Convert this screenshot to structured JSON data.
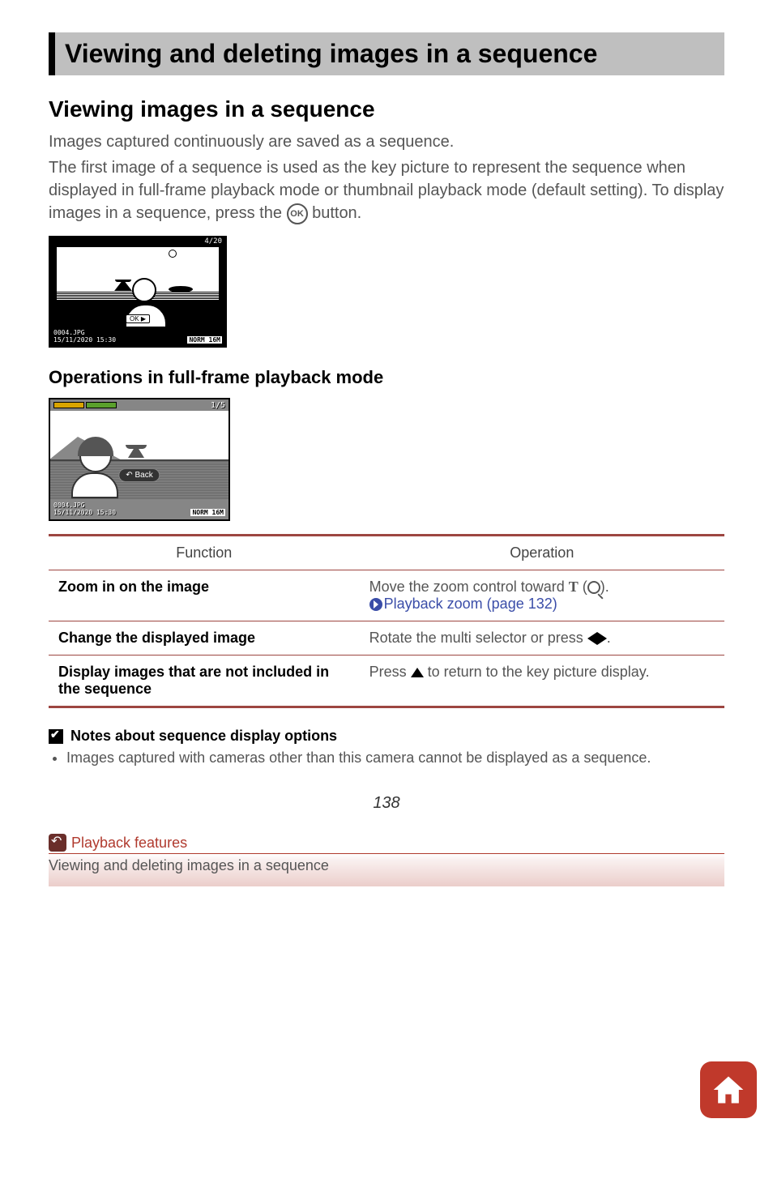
{
  "title": "Viewing and deleting images in a sequence",
  "section1": "Viewing images in a sequence",
  "para1a": "Images captured continuously are saved as a sequence.",
  "para1b_pre": "The first image of a sequence is used as the key picture to represent the sequence when displayed in full-frame playback mode or thumbnail playback mode (default setting). To display images in a sequence, press the ",
  "para1b_post": " button.",
  "ok_label": "OK",
  "lcd": {
    "counter": "4/20",
    "ok_play": "OK ▶",
    "filename": "0004.JPG",
    "datetime": "15/11/2020 15:30",
    "norm": "NORM 16M"
  },
  "section2": "Operations in full-frame playback mode",
  "lcd2": {
    "counter": "1/5",
    "back": "Back",
    "filename": "0004.JPG",
    "datetime": "15/11/2020 15:30",
    "norm": "NORM 16M"
  },
  "table": {
    "head_fn": "Function",
    "head_op": "Operation",
    "row1_fn": "Zoom in on the image",
    "row1_op_a": "Move the zoom control toward ",
    "row1_op_T": "T",
    "row1_op_b": " (",
    "row1_op_c": ").",
    "row1_link": "Playback zoom (page 132)",
    "row2_fn": "Change the displayed image",
    "row2_op_a": "Rotate the multi selector or press ",
    "row2_op_b": ".",
    "row3_fn": "Display images that are not included in the sequence",
    "row3_op_a": "Press ",
    "row3_op_b": " to return to the key picture display."
  },
  "notes_head": "Notes about sequence display options",
  "note1": "Images captured with cameras other than this camera cannot be displayed as a sequence.",
  "pageno": "138",
  "footer_link": "Playback features",
  "footer_sub": "Viewing and deleting images in a sequence"
}
